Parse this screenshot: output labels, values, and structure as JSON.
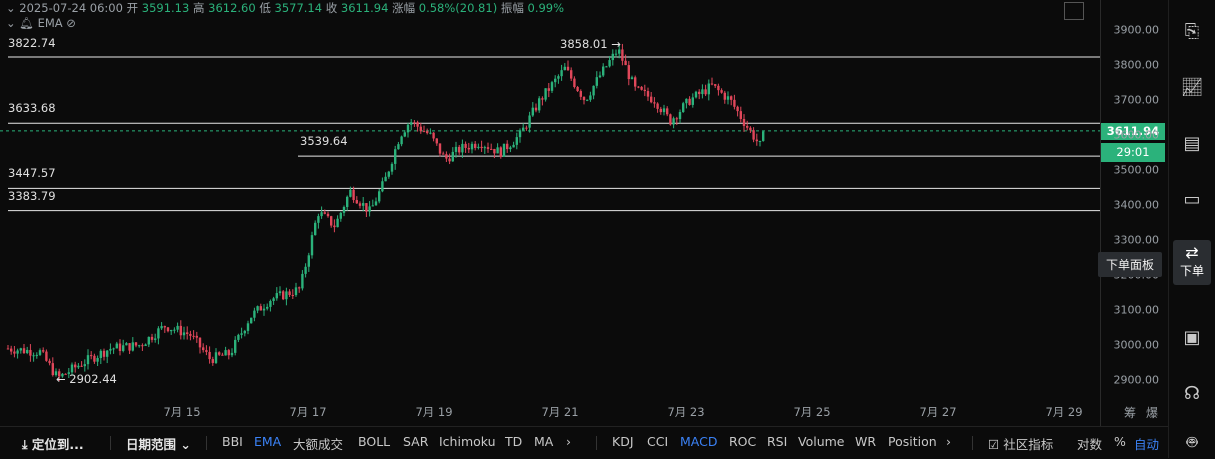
{
  "info_bar": {
    "date": "2025-07-24 06:00",
    "open_label": "开",
    "open": "3591.13",
    "high_label": "高",
    "high": "3612.60",
    "low_label": "低",
    "low": "3577.14",
    "close_label": "收",
    "close": "3611.94",
    "change_label": "涨幅",
    "change": "0.58%(20.81)",
    "amp_label": "振幅",
    "amp": "0.99%"
  },
  "indicator_row": {
    "ema_label": "EMA"
  },
  "levels": [
    {
      "label": "3822.74",
      "price": 3822.74
    },
    {
      "label": "3633.68",
      "price": 3633.68
    },
    {
      "label": "3539.64",
      "price": 3539.64
    },
    {
      "label": "3447.57",
      "price": 3447.57
    },
    {
      "label": "3383.79",
      "price": 3383.79
    }
  ],
  "annotations": {
    "high_marker": "3858.01 →",
    "low_marker": "← 2902.44"
  },
  "y_axis": {
    "ticks": [
      "3900.00",
      "3800.00",
      "3700.00",
      "3600.00",
      "3500.00",
      "3400.00",
      "3300.00",
      "3200.00",
      "3100.00",
      "3000.00",
      "2900.00"
    ]
  },
  "price_tag": {
    "price": "3611.94",
    "countdown": "29:01"
  },
  "x_axis": {
    "labels": [
      "7月 15",
      "7月 17",
      "7月 19",
      "7月 21",
      "7月 23",
      "7月 25",
      "7月 27",
      "7月 29"
    ],
    "extra": [
      "筹",
      "爆"
    ]
  },
  "hover_chip": "下单面板",
  "sidebar": {
    "active_label": "下单"
  },
  "toolbar": {
    "locate": "定位到...",
    "date_range": "日期范围",
    "main_indicators": [
      "BBI",
      "EMA",
      "大额成交",
      "BOLL",
      "SAR",
      "Ichimoku",
      "TD",
      "MA"
    ],
    "sub_indicators": [
      "KDJ",
      "CCI",
      "MACD",
      "ROC",
      "RSI",
      "Volume",
      "WR",
      "Position"
    ],
    "community": "社区指标",
    "log": "对数",
    "percent": "%",
    "auto": "自动"
  },
  "colors": {
    "up": "#2bb27b",
    "down": "#e0475a",
    "accent": "#3b82f6"
  }
}
